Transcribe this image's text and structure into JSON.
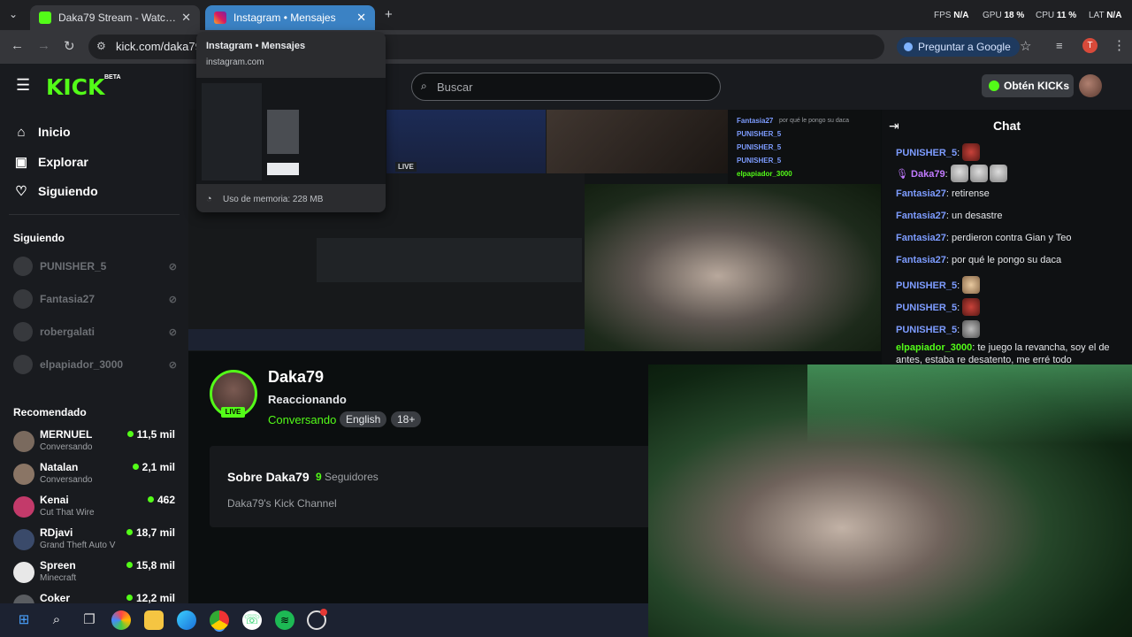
{
  "browser": {
    "tabs": [
      {
        "title": "Daka79 Stream - Watch Live on Kick",
        "active": false
      },
      {
        "title": "Instagram • Mensajes",
        "active": true
      }
    ],
    "url": "kick.com/daka79",
    "ask_google": "Preguntar a Google",
    "perf": {
      "fps_label": "FPS",
      "fps": "N/A",
      "gpu_label": "GPU",
      "gpu": "18 %",
      "cpu_label": "CPU",
      "cpu": "11 %",
      "lat_label": "LAT",
      "lat": "N/A"
    },
    "profile_initial": "T"
  },
  "hover_card": {
    "title": "Instagram • Mensajes",
    "url": "instagram.com",
    "memory": "Uso de memoria: 228 MB"
  },
  "header": {
    "logo": "KICK",
    "logo_badge": "BETA",
    "search_placeholder": "Buscar",
    "kicks_button": "Obtén KICKs"
  },
  "sidebar": {
    "nav": [
      {
        "label": "Inicio",
        "icon": "home-icon"
      },
      {
        "label": "Explorar",
        "icon": "compass-icon"
      },
      {
        "label": "Siguiendo",
        "icon": "heart-icon"
      }
    ],
    "following_title": "Siguiendo",
    "following": [
      "PUNISHER_5",
      "Fantasia27",
      "robergalati",
      "elpapiador_3000"
    ],
    "recommended_title": "Recomendado",
    "recommended": [
      {
        "name": "MERNUEL",
        "category": "Conversando",
        "viewers": "11,5 mil",
        "color": "#7a6a5e"
      },
      {
        "name": "Natalan",
        "category": "Conversando",
        "viewers": "2,1 mil",
        "color": "#8a7565"
      },
      {
        "name": "Kenai",
        "category": "Cut That Wire",
        "viewers": "462",
        "color": "#c33a6a"
      },
      {
        "name": "RDjavi",
        "category": "Grand Theft Auto V",
        "viewers": "18,7 mil",
        "color": "#3a4a6a"
      },
      {
        "name": "Spreen",
        "category": "Minecraft",
        "viewers": "15,8 mil",
        "color": "#e8e8e8"
      },
      {
        "name": "Coker",
        "category": "",
        "viewers": "12,2 mil",
        "color": "#5a5d61"
      }
    ]
  },
  "video": {
    "mini_live": "LIVE",
    "mini_chat": [
      {
        "user": "Fantasia27",
        "text": "por qué le pongo su daca"
      },
      {
        "user": "PUNISHER_5",
        "text": ""
      },
      {
        "user": "PUNISHER_5",
        "text": ""
      },
      {
        "user": "PUNISHER_5",
        "text": ""
      },
      {
        "user": "elpapiador_3000",
        "text": "te juego la revancha, soy el de antes, estaba re desatento, me erré todo"
      }
    ]
  },
  "channel": {
    "name": "Daka79",
    "live": "LIVE",
    "title": "Reaccionando",
    "category": "Conversando",
    "tags": [
      "English",
      "18+"
    ],
    "about_title": "Sobre Daka79",
    "followers_count": "9",
    "followers_label": "Seguidores",
    "description": "Daka79's Kick Channel"
  },
  "chat": {
    "title": "Chat",
    "messages": [
      {
        "user": "PUNISHER_5",
        "color": "#7d9cff",
        "text": "",
        "emotes": 1
      },
      {
        "user": "Daka79",
        "color": "#c27bff",
        "text": "",
        "emotes": 3
      },
      {
        "user": "Fantasia27",
        "color": "#7d9cff",
        "text": "retirense",
        "emotes": 0
      },
      {
        "user": "Fantasia27",
        "color": "#7d9cff",
        "text": "un desastre",
        "emotes": 0
      },
      {
        "user": "Fantasia27",
        "color": "#7d9cff",
        "text": "perdieron contra Gian y Teo",
        "emotes": 0
      },
      {
        "user": "Fantasia27",
        "color": "#7d9cff",
        "text": "por qué le pongo su daca",
        "emotes": 0
      },
      {
        "user": "PUNISHER_5",
        "color": "#7d9cff",
        "text": "",
        "emotes": 1
      },
      {
        "user": "PUNISHER_5",
        "color": "#7d9cff",
        "text": "",
        "emotes": 1
      },
      {
        "user": "PUNISHER_5",
        "color": "#7d9cff",
        "text": "",
        "emotes": 1
      },
      {
        "user": "elpapiador_3000",
        "color": "#53fc18",
        "text": "te juego la revancha, soy el de antes, estaba re desatento, me erré todo",
        "emotes": 0
      }
    ]
  },
  "taskbar": {
    "icons": [
      "windows-start-icon",
      "search-icon",
      "task-view-icon",
      "paint-icon",
      "file-explorer-icon",
      "edge-icon",
      "chrome-icon",
      "whatsapp-icon",
      "spotify-icon",
      "obs-icon"
    ]
  },
  "colors": {
    "accent": "#53fc18",
    "chat_user": "#7d9cff",
    "background": "#0b0e0f"
  }
}
